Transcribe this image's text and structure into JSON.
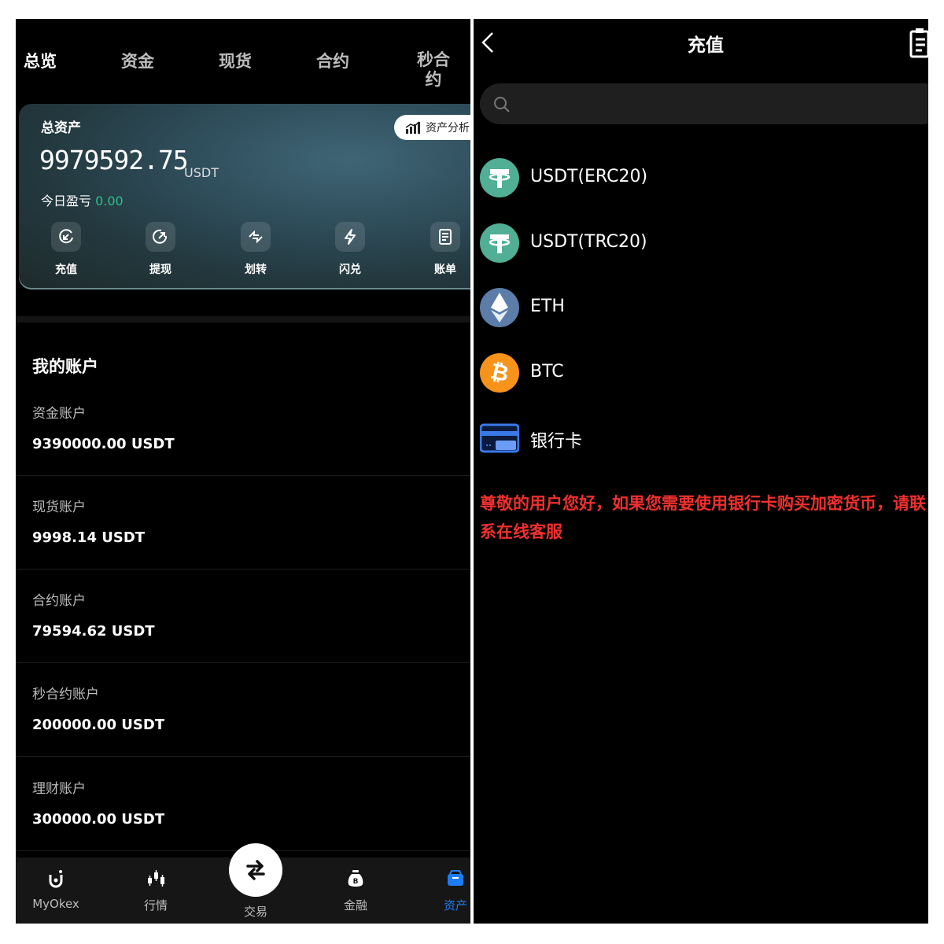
{
  "left": {
    "tabs": [
      "总览",
      "资金",
      "现货",
      "合约",
      "秒合约"
    ],
    "active_tab": "总览",
    "asset_card": {
      "title": "总资产",
      "analysis_label": "资产分析",
      "value": "9979592.75",
      "unit": "USDT",
      "pnl_label": "今日盈亏",
      "pnl_value": "0.00",
      "actions": [
        "充值",
        "提现",
        "划转",
        "闪兑",
        "账单"
      ]
    },
    "section_title": "我的账户",
    "accounts": [
      {
        "name": "资金账户",
        "value": "9390000.00 USDT"
      },
      {
        "name": "现货账户",
        "value": "9998.14 USDT"
      },
      {
        "name": "合约账户",
        "value": "79594.62 USDT"
      },
      {
        "name": "秒合约账户",
        "value": "200000.00 USDT"
      },
      {
        "name": "理财账户",
        "value": "300000.00 USDT"
      }
    ],
    "bottom_nav": [
      "MyOkex",
      "行情",
      "交易",
      "金融",
      "资产"
    ],
    "active_nav": "资产"
  },
  "right": {
    "title": "充值",
    "search_placeholder": "",
    "coins": [
      "USDT(ERC20)",
      "USDT(TRC20)",
      "ETH",
      "BTC",
      "银行卡"
    ],
    "notice": "尊敬的用户您好，如果您需要使用银行卡购买加密货币，请联系在线客服"
  },
  "colors": {
    "background": "#000000",
    "accent_blue": "#1e7cf5",
    "profit_green": "#27c28a",
    "notice_red": "#f0302e",
    "usdt_green": "#50af95",
    "btc_orange": "#f7931a",
    "eth_blue": "#627eea"
  },
  "icons": [
    "chevron-left-icon",
    "history-icon",
    "search-icon",
    "tether-icon",
    "ethereum-icon",
    "bitcoin-icon",
    "bank-card-icon"
  ]
}
